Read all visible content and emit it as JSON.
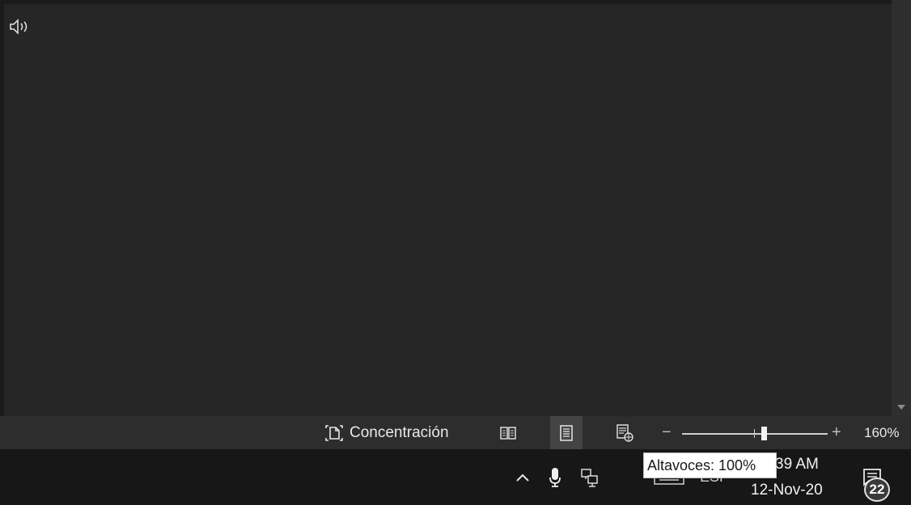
{
  "statusbar": {
    "focus_label": "Concentración",
    "zoom_minus": "−",
    "zoom_plus": "+",
    "zoom_level": "160%",
    "zoom_slider_value": 0.55,
    "views": [
      "read-mode",
      "print-layout",
      "web-layout"
    ],
    "active_view": "print-layout"
  },
  "taskbar": {
    "language": "ESP",
    "time": "39 AM",
    "date": "12-Nov-20",
    "notification_count": "22",
    "highlight_color": "#e01e1e"
  },
  "tooltip": {
    "text": "Altavoces: 100%"
  },
  "icons": [
    "focus-icon",
    "read-mode-icon",
    "print-layout-icon",
    "web-layout-icon",
    "chevron-up-icon",
    "microphone-icon",
    "network-icon",
    "speaker-icon",
    "keyboard-icon",
    "notification-icon"
  ]
}
